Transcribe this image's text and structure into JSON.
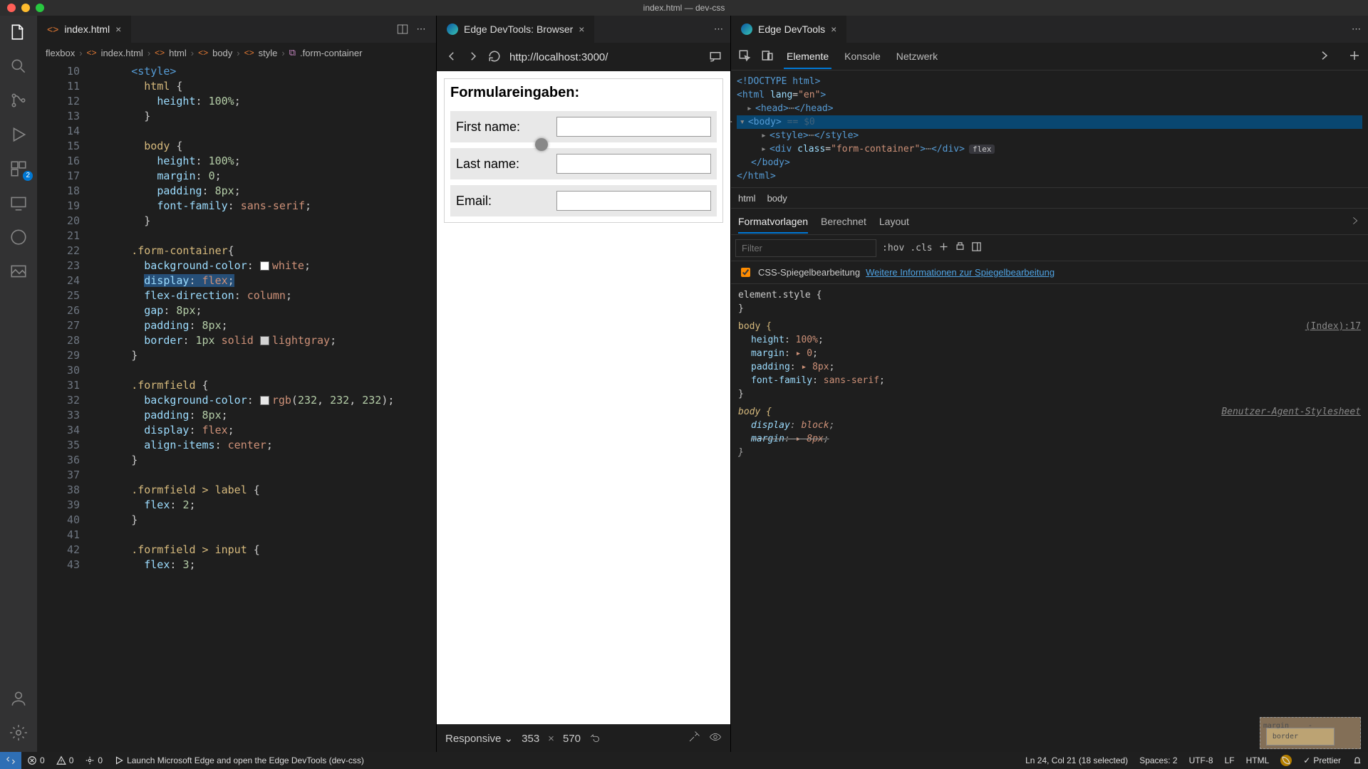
{
  "window_title": "index.html — dev-css",
  "activity": {
    "ext_badge": "2"
  },
  "editor": {
    "tab_label": "index.html",
    "breadcrumb": [
      "flexbox",
      "index.html",
      "html",
      "body",
      "style",
      ".form-container"
    ],
    "line_start": 10,
    "lines": [
      {
        "indent": 2,
        "tokens": [
          [
            "tag",
            "<style"
          ],
          [
            "tag",
            ">"
          ]
        ]
      },
      {
        "indent": 3,
        "tokens": [
          [
            "sel",
            "html"
          ],
          [
            "punc",
            " {"
          ]
        ]
      },
      {
        "indent": 4,
        "tokens": [
          [
            "prop",
            "height"
          ],
          [
            "punc",
            ": "
          ],
          [
            "num",
            "100%"
          ],
          [
            "punc",
            ";"
          ]
        ]
      },
      {
        "indent": 3,
        "tokens": [
          [
            "punc",
            "}"
          ]
        ]
      },
      {
        "indent": 3,
        "tokens": []
      },
      {
        "indent": 3,
        "tokens": [
          [
            "sel",
            "body"
          ],
          [
            "punc",
            " {"
          ]
        ]
      },
      {
        "indent": 4,
        "tokens": [
          [
            "prop",
            "height"
          ],
          [
            "punc",
            ": "
          ],
          [
            "num",
            "100%"
          ],
          [
            "punc",
            ";"
          ]
        ]
      },
      {
        "indent": 4,
        "tokens": [
          [
            "prop",
            "margin"
          ],
          [
            "punc",
            ": "
          ],
          [
            "num",
            "0"
          ],
          [
            "punc",
            ";"
          ]
        ]
      },
      {
        "indent": 4,
        "tokens": [
          [
            "prop",
            "padding"
          ],
          [
            "punc",
            ": "
          ],
          [
            "num",
            "8px"
          ],
          [
            "punc",
            ";"
          ]
        ]
      },
      {
        "indent": 4,
        "tokens": [
          [
            "prop",
            "font-family"
          ],
          [
            "punc",
            ": "
          ],
          [
            "val",
            "sans-serif"
          ],
          [
            "punc",
            ";"
          ]
        ]
      },
      {
        "indent": 3,
        "tokens": [
          [
            "punc",
            "}"
          ]
        ]
      },
      {
        "indent": 3,
        "tokens": []
      },
      {
        "indent": 2,
        "tokens": [
          [
            "sel",
            ".form-container"
          ],
          [
            "punc",
            "{"
          ]
        ]
      },
      {
        "indent": 3,
        "tokens": [
          [
            "prop",
            "background-color"
          ],
          [
            "punc",
            ": "
          ],
          [
            "swatch",
            "#fff"
          ],
          [
            "val",
            "white"
          ],
          [
            "punc",
            ";"
          ]
        ]
      },
      {
        "indent": 3,
        "hl": true,
        "tokens": [
          [
            "prop",
            "display"
          ],
          [
            "punc",
            ": "
          ],
          [
            "val",
            "flex"
          ],
          [
            "punc",
            ";"
          ]
        ]
      },
      {
        "indent": 3,
        "tokens": [
          [
            "prop",
            "flex-direction"
          ],
          [
            "punc",
            ": "
          ],
          [
            "val",
            "column"
          ],
          [
            "punc",
            ";"
          ]
        ]
      },
      {
        "indent": 3,
        "tokens": [
          [
            "prop",
            "gap"
          ],
          [
            "punc",
            ": "
          ],
          [
            "num",
            "8px"
          ],
          [
            "punc",
            ";"
          ]
        ]
      },
      {
        "indent": 3,
        "tokens": [
          [
            "prop",
            "padding"
          ],
          [
            "punc",
            ": "
          ],
          [
            "num",
            "8px"
          ],
          [
            "punc",
            ";"
          ]
        ]
      },
      {
        "indent": 3,
        "tokens": [
          [
            "prop",
            "border"
          ],
          [
            "punc",
            ": "
          ],
          [
            "num",
            "1px"
          ],
          [
            "punc",
            " "
          ],
          [
            "val",
            "solid"
          ],
          [
            "punc",
            " "
          ],
          [
            "swatch",
            "#d3d3d3"
          ],
          [
            "val",
            "lightgray"
          ],
          [
            "punc",
            ";"
          ]
        ]
      },
      {
        "indent": 2,
        "tokens": [
          [
            "punc",
            "}"
          ]
        ]
      },
      {
        "indent": 2,
        "tokens": []
      },
      {
        "indent": 2,
        "tokens": [
          [
            "sel",
            ".formfield"
          ],
          [
            "punc",
            " {"
          ]
        ]
      },
      {
        "indent": 3,
        "tokens": [
          [
            "prop",
            "background-color"
          ],
          [
            "punc",
            ": "
          ],
          [
            "swatch",
            "rgb(232,232,232)"
          ],
          [
            "val",
            "rgb"
          ],
          [
            "punc",
            "("
          ],
          [
            "num",
            "232"
          ],
          [
            "punc",
            ", "
          ],
          [
            "num",
            "232"
          ],
          [
            "punc",
            ", "
          ],
          [
            "num",
            "232"
          ],
          [
            "punc",
            ")"
          ],
          [
            "punc",
            ";"
          ]
        ]
      },
      {
        "indent": 3,
        "tokens": [
          [
            "prop",
            "padding"
          ],
          [
            "punc",
            ": "
          ],
          [
            "num",
            "8px"
          ],
          [
            "punc",
            ";"
          ]
        ]
      },
      {
        "indent": 3,
        "tokens": [
          [
            "prop",
            "display"
          ],
          [
            "punc",
            ": "
          ],
          [
            "val",
            "flex"
          ],
          [
            "punc",
            ";"
          ]
        ]
      },
      {
        "indent": 3,
        "tokens": [
          [
            "prop",
            "align-items"
          ],
          [
            "punc",
            ": "
          ],
          [
            "val",
            "center"
          ],
          [
            "punc",
            ";"
          ]
        ]
      },
      {
        "indent": 2,
        "tokens": [
          [
            "punc",
            "}"
          ]
        ]
      },
      {
        "indent": 2,
        "tokens": []
      },
      {
        "indent": 2,
        "tokens": [
          [
            "sel",
            ".formfield > label"
          ],
          [
            "punc",
            " {"
          ]
        ]
      },
      {
        "indent": 3,
        "tokens": [
          [
            "prop",
            "flex"
          ],
          [
            "punc",
            ": "
          ],
          [
            "num",
            "2"
          ],
          [
            "punc",
            ";"
          ]
        ]
      },
      {
        "indent": 2,
        "tokens": [
          [
            "punc",
            "}"
          ]
        ]
      },
      {
        "indent": 2,
        "tokens": []
      },
      {
        "indent": 2,
        "tokens": [
          [
            "sel",
            ".formfield > input"
          ],
          [
            "punc",
            " {"
          ]
        ]
      },
      {
        "indent": 3,
        "tokens": [
          [
            "prop",
            "flex"
          ],
          [
            "punc",
            ": "
          ],
          [
            "num",
            "3"
          ],
          [
            "punc",
            ";"
          ]
        ]
      }
    ]
  },
  "browser": {
    "tab_label": "Edge DevTools: Browser",
    "url": "http://localhost:3000/",
    "form_title": "Formulareingaben:",
    "fields": [
      {
        "label": "First name:"
      },
      {
        "label": "Last name:"
      },
      {
        "label": "Email:"
      }
    ],
    "device": {
      "mode": "Responsive",
      "width": "353",
      "height": "570"
    }
  },
  "devtools": {
    "tab_label": "Edge DevTools",
    "toolbar_tabs": [
      "Elemente",
      "Konsole",
      "Netzwerk"
    ],
    "dom": {
      "doctype": "<!DOCTYPE html>",
      "html_open": "<html lang=\"en\">",
      "head": "<head>⋯</head>",
      "body_open": "<body>",
      "body_hint": "== $0",
      "style": "<style>⋯</style>",
      "div": "<div class=\"form-container\">⋯</div>",
      "flex_badge": "flex",
      "body_close": "</body>",
      "html_close": "</html>"
    },
    "crumbs": [
      "html",
      "body"
    ],
    "styles_tabs": [
      "Formatvorlagen",
      "Berechnet",
      "Layout"
    ],
    "filter_placeholder": "Filter",
    "hov": ":hov",
    "cls": ".cls",
    "mirror_checkbox": "CSS-Spiegelbearbeitung",
    "mirror_link": "Weitere Informationen zur Spiegelbearbeitung",
    "rules": {
      "element_style": "element.style {",
      "body_sel": "body {",
      "body_src": "(Index):17",
      "body_props": [
        [
          "height",
          "100%"
        ],
        [
          "margin",
          "▸ 0"
        ],
        [
          "padding",
          "▸ 8px"
        ],
        [
          "font-family",
          "sans-serif"
        ]
      ],
      "ua_sel": "body {",
      "ua_src": "Benutzer-Agent-Stylesheet",
      "ua_props": [
        [
          "display",
          "block"
        ],
        [
          "margin",
          "▸ 8px"
        ]
      ]
    },
    "box_model": {
      "margin": "margin",
      "border": "border",
      "dash": "-"
    }
  },
  "status": {
    "errors": "0",
    "warnings": "0",
    "ports": "0",
    "launch": "Launch Microsoft Edge and open the Edge DevTools (dev-css)",
    "cursor": "Ln 24, Col 21 (18 selected)",
    "spaces": "Spaces: 2",
    "encoding": "UTF-8",
    "eol": "LF",
    "lang": "HTML",
    "prettier": "Prettier"
  }
}
